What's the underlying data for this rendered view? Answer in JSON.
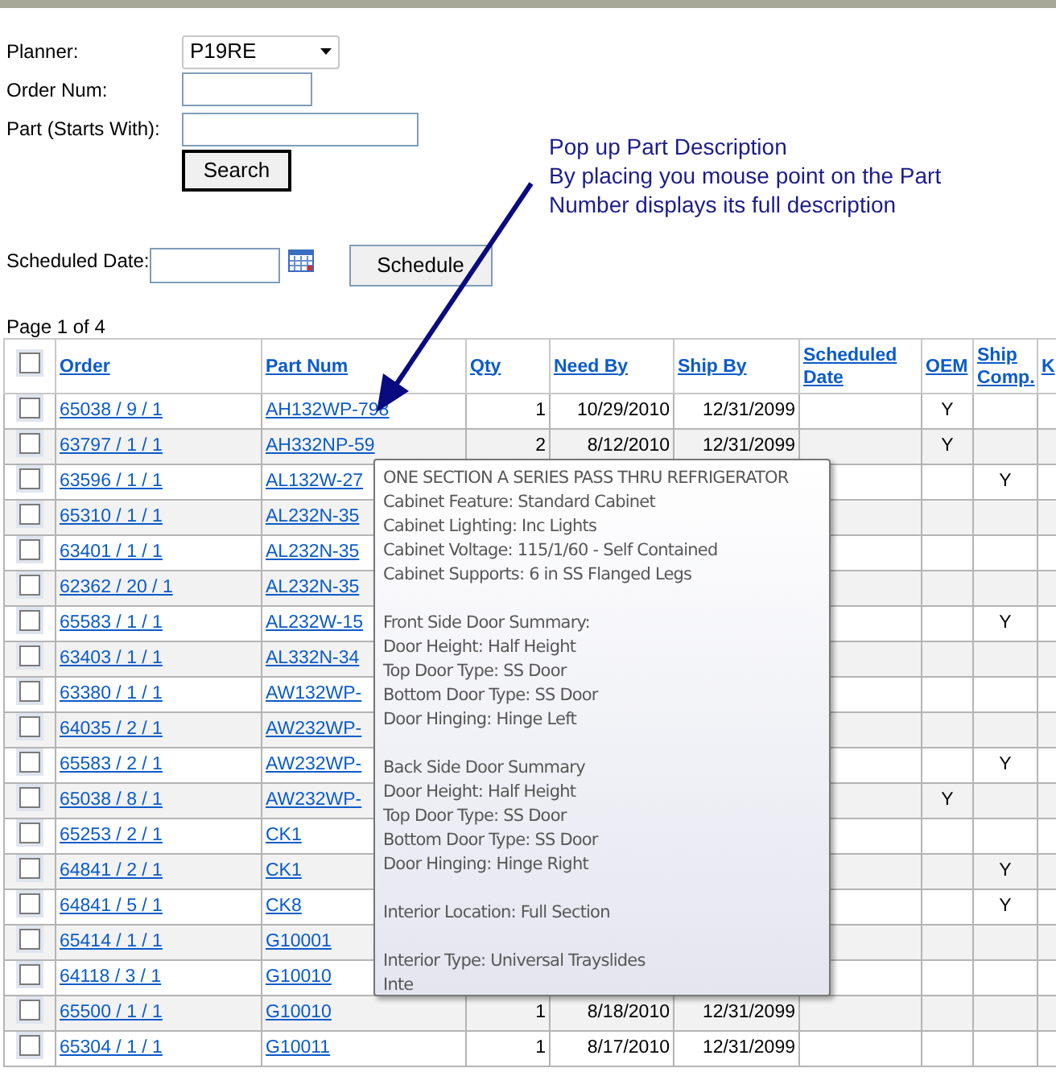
{
  "form": {
    "planner": {
      "label": "Planner:",
      "value": "P19RE"
    },
    "order_num": {
      "label": "Order Num:"
    },
    "part": {
      "label": "Part (Starts With):"
    },
    "search_button": "Search",
    "scheduled_date": {
      "label": "Scheduled Date:"
    },
    "schedule_button": "Schedule"
  },
  "annotation": {
    "lines": [
      "Pop up Part Description",
      "By placing you mouse point on the Part",
      "Number displays its full description"
    ]
  },
  "pager": "Page 1 of 4",
  "table": {
    "select_all": {
      "checked": false
    },
    "columns": [
      "Order",
      "Part Num",
      "Qty",
      "Need By",
      "Ship By",
      "Scheduled Date",
      "OEM",
      "Ship Comp.",
      "K"
    ],
    "rows": [
      {
        "checked": false,
        "order": "65038 / 9 / 1",
        "part": "AH132WP-798",
        "qty": "1",
        "need_by": "10/29/2010",
        "ship_by": "12/31/2099",
        "oem": "Y"
      },
      {
        "checked": false,
        "order": "63797 / 1 / 1",
        "part": "AH332NP-59",
        "qty": "2",
        "need_by": "8/12/2010",
        "ship_by": "12/31/2099",
        "oem": "Y"
      },
      {
        "checked": false,
        "order": "63596 / 1 / 1",
        "part": "AL132W-27",
        "ship_comp": "Y"
      },
      {
        "checked": false,
        "order": "65310 / 1 / 1",
        "part": "AL232N-35"
      },
      {
        "checked": false,
        "order": "63401 / 1 / 1",
        "part": "AL232N-35"
      },
      {
        "checked": false,
        "order": "62362 / 20 / 1",
        "part": "AL232N-35"
      },
      {
        "checked": false,
        "order": "65583 / 1 / 1",
        "part": "AL232W-15",
        "ship_comp": "Y"
      },
      {
        "checked": false,
        "order": "63403 / 1 / 1",
        "part": "AL332N-34"
      },
      {
        "checked": false,
        "order": "63380 / 1 / 1",
        "part": "AW132WP-"
      },
      {
        "checked": false,
        "order": "64035 / 2 / 1",
        "part": "AW232WP-"
      },
      {
        "checked": false,
        "order": "65583 / 2 / 1",
        "part": "AW232WP-",
        "ship_comp": "Y"
      },
      {
        "checked": false,
        "order": "65038 / 8 / 1",
        "part": "AW232WP-",
        "oem": "Y"
      },
      {
        "checked": false,
        "order": "65253 / 2 / 1",
        "part": "CK1"
      },
      {
        "checked": false,
        "order": "64841 / 2 / 1",
        "part": "CK1",
        "ship_comp": "Y"
      },
      {
        "checked": false,
        "order": "64841 / 5 / 1",
        "part": "CK8",
        "ship_comp": "Y"
      },
      {
        "checked": false,
        "order": "65414 / 1 / 1",
        "part": "G10001"
      },
      {
        "checked": false,
        "order": "64118 / 3 / 1",
        "part": "G10010"
      },
      {
        "checked": false,
        "order": "65500 / 1 / 1",
        "part": "G10010",
        "qty": "1",
        "need_by": "8/18/2010",
        "ship_by": "12/31/2099"
      },
      {
        "checked": false,
        "order": "65304 / 1 / 1",
        "part": "G10011",
        "qty": "1",
        "need_by": "8/17/2010",
        "ship_by": "12/31/2099"
      }
    ]
  },
  "tooltip": {
    "paragraphs": [
      [
        "ONE SECTION A SERIES PASS THRU REFRIGERATOR",
        "Cabinet Feature: Standard Cabinet",
        "Cabinet Lighting: Inc Lights",
        "Cabinet Voltage: 115/1/60 - Self Contained",
        "Cabinet Supports: 6 in SS Flanged Legs"
      ],
      [
        "Front Side Door Summary:",
        "Door Height: Half Height",
        "Top Door Type: SS Door",
        "Bottom Door Type: SS Door",
        "Door Hinging: Hinge Left"
      ],
      [
        "Back Side Door Summary",
        "Door Height: Half Height",
        "Top Door Type: SS Door",
        "Bottom Door Type: SS Door",
        "Door Hinging: Hinge Right"
      ],
      [
        "Interior Location: Full Section"
      ],
      [
        "Interior Type: Universal Trayslides",
        "Inte"
      ]
    ]
  }
}
